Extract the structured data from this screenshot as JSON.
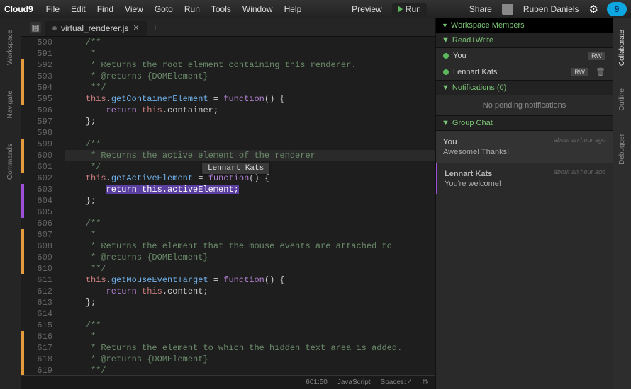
{
  "menubar": {
    "logo": "Cloud9",
    "items": [
      "File",
      "Edit",
      "Find",
      "View",
      "Goto",
      "Run",
      "Tools",
      "Window",
      "Help"
    ],
    "preview": "Preview",
    "run": "Run",
    "share": "Share",
    "user": "Ruben Daniels",
    "cloud_num": "9"
  },
  "left_rail": [
    "Workspace",
    "Navigate",
    "Commands"
  ],
  "right_rail": [
    "Collaborate",
    "Outline",
    "Debugger"
  ],
  "tab": {
    "filename": "virtual_renderer.js"
  },
  "gutter": {
    "start": 590,
    "end": 620
  },
  "code_lines": [
    {
      "n": 590,
      "t": "    /**",
      "cls": "c-comment"
    },
    {
      "n": 591,
      "t": "     *",
      "cls": "c-comment"
    },
    {
      "n": 592,
      "t": "     * Returns the root element containing this renderer.",
      "cls": "c-comment"
    },
    {
      "n": 593,
      "t": "     * @returns {DOMElement}",
      "cls": "c-comment"
    },
    {
      "n": 594,
      "t": "     **/",
      "cls": "c-comment"
    },
    {
      "n": 595,
      "parts": [
        [
          "    ",
          ""
        ],
        [
          "this",
          "c-this"
        ],
        [
          ".",
          ""
        ],
        [
          "getContainerElement",
          "c-func"
        ],
        [
          " = ",
          ""
        ],
        [
          "function",
          "c-keyword"
        ],
        [
          "() {",
          ""
        ]
      ]
    },
    {
      "n": 596,
      "parts": [
        [
          "        ",
          ""
        ],
        [
          "return",
          "c-keyword"
        ],
        [
          " ",
          ""
        ],
        [
          "this",
          "c-this"
        ],
        [
          ".container;",
          ""
        ]
      ]
    },
    {
      "n": 597,
      "t": "    };"
    },
    {
      "n": 598,
      "t": ""
    },
    {
      "n": 599,
      "t": "    /**",
      "cls": "c-comment"
    },
    {
      "n": 600,
      "t": "     * Returns the active element of the renderer",
      "cls": "c-comment",
      "hl": true
    },
    {
      "n": 601,
      "t": "     */",
      "cls": "c-comment"
    },
    {
      "n": 602,
      "parts": [
        [
          "    ",
          ""
        ],
        [
          "this",
          "c-this"
        ],
        [
          ".",
          ""
        ],
        [
          "getActiveElement",
          "c-func"
        ],
        [
          " = ",
          ""
        ],
        [
          "function",
          "c-keyword"
        ],
        [
          "() {",
          ""
        ]
      ]
    },
    {
      "n": 603,
      "sel": "        return this.activeElement;"
    },
    {
      "n": 604,
      "t": "    };"
    },
    {
      "n": 605,
      "t": ""
    },
    {
      "n": 606,
      "t": "    /**",
      "cls": "c-comment"
    },
    {
      "n": 607,
      "t": "     *",
      "cls": "c-comment"
    },
    {
      "n": 608,
      "t": "     * Returns the element that the mouse events are attached to",
      "cls": "c-comment"
    },
    {
      "n": 609,
      "t": "     * @returns {DOMElement}",
      "cls": "c-comment"
    },
    {
      "n": 610,
      "t": "     **/",
      "cls": "c-comment"
    },
    {
      "n": 611,
      "parts": [
        [
          "    ",
          ""
        ],
        [
          "this",
          "c-this"
        ],
        [
          ".",
          ""
        ],
        [
          "getMouseEventTarget",
          "c-func"
        ],
        [
          " = ",
          ""
        ],
        [
          "function",
          "c-keyword"
        ],
        [
          "() {",
          ""
        ]
      ]
    },
    {
      "n": 612,
      "parts": [
        [
          "        ",
          ""
        ],
        [
          "return",
          "c-keyword"
        ],
        [
          " ",
          ""
        ],
        [
          "this",
          "c-this"
        ],
        [
          ".content;",
          ""
        ]
      ]
    },
    {
      "n": 613,
      "t": "    };"
    },
    {
      "n": 614,
      "t": ""
    },
    {
      "n": 615,
      "t": "    /**",
      "cls": "c-comment"
    },
    {
      "n": 616,
      "t": "     *",
      "cls": "c-comment"
    },
    {
      "n": 617,
      "t": "     * Returns the element to which the hidden text area is added.",
      "cls": "c-comment"
    },
    {
      "n": 618,
      "t": "     * @returns {DOMElement}",
      "cls": "c-comment"
    },
    {
      "n": 619,
      "t": "     **/",
      "cls": "c-comment"
    }
  ],
  "cursor_hint": "Lennart Kats",
  "statusbar": {
    "pos": "601:50",
    "lang": "JavaScript",
    "spaces": "Spaces: 4"
  },
  "collab": {
    "members_title": "Workspace Members",
    "rw_title": "Read+Write",
    "members": [
      {
        "name": "You",
        "badge": "RW",
        "trash": false
      },
      {
        "name": "Lennart Kats",
        "badge": "RW",
        "trash": true
      }
    ],
    "notif_title": "Notifications (0)",
    "notif_body": "No pending notifications",
    "chat_title": "Group Chat",
    "messages": [
      {
        "name": "You",
        "time": "about an hour ago",
        "text": "Awesome! Thanks!",
        "alt": true
      },
      {
        "name": "Lennart Kats",
        "time": "about an hour ago",
        "text": "You're welcome!",
        "alt": false
      }
    ]
  }
}
